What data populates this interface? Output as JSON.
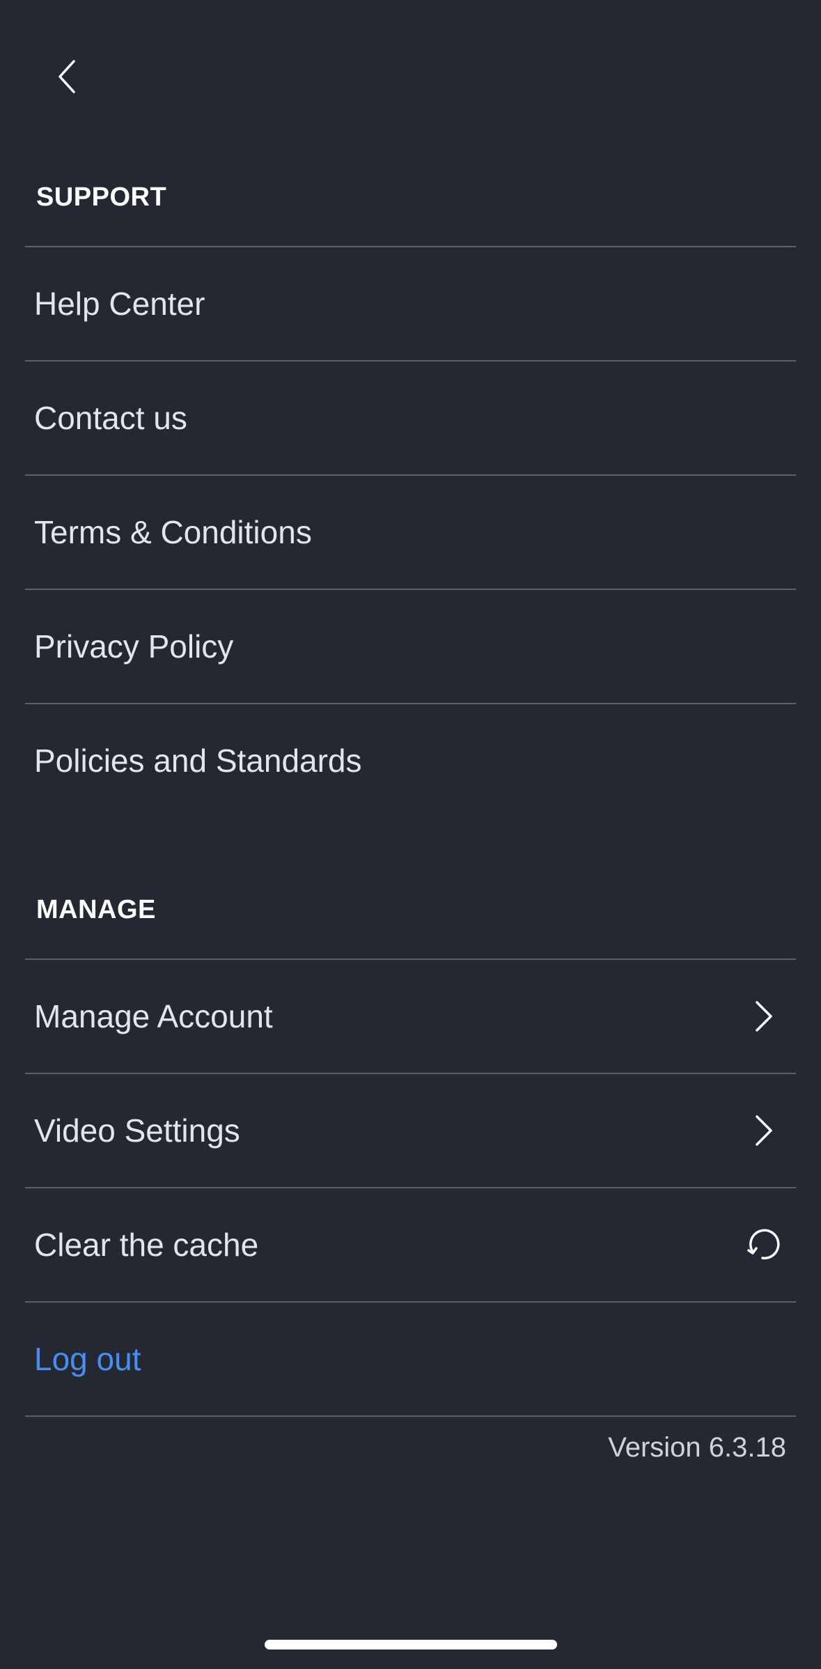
{
  "nav": {
    "back_icon": "chevron-left-icon"
  },
  "support": {
    "title": "SUPPORT",
    "items": [
      {
        "label": "Help Center"
      },
      {
        "label": "Contact us"
      },
      {
        "label": "Terms & Conditions"
      },
      {
        "label": "Privacy Policy"
      },
      {
        "label": "Policies and Standards"
      }
    ]
  },
  "manage": {
    "title": "MANAGE",
    "items": [
      {
        "label": "Manage Account",
        "icon": "chevron-right-icon"
      },
      {
        "label": "Video Settings",
        "icon": "chevron-right-icon"
      },
      {
        "label": "Clear the cache",
        "icon": "refresh-icon"
      }
    ]
  },
  "logout": {
    "label": "Log out",
    "color": "#4a8df2"
  },
  "footer": {
    "version": "Version 6.3.18"
  },
  "theme": {
    "background": "#242833",
    "divider": "#5a5f6b",
    "text": "#e3e5ea"
  }
}
